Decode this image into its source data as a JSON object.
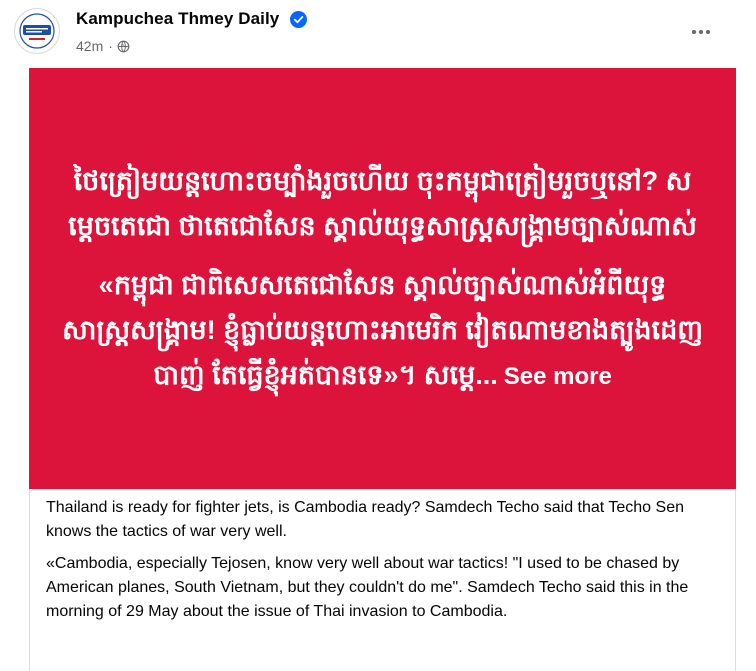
{
  "post": {
    "page_name": "Kampuchea Thmey Daily",
    "time": "42m",
    "separator": "·",
    "verified_icon": "verified-check-icon",
    "privacy_icon": "globe-icon",
    "menu_icon": "more-horizontal-icon"
  },
  "media": {
    "background_color": "#dc143c",
    "headline": "ថៃត្រៀមយន្តហោះចម្បាំងរួចហើយ ចុះកម្ពុជាត្រៀមរួចឬនៅ? សម្តេចតេជោ ថាតេជោសែន ស្គាល់យុទ្ធសាស្ត្រសង្គ្រាមច្បាស់ណាស់",
    "quote": "«កម្ពុជា ជាពិសេសតេជោសែន ស្គាល់ច្បាស់ណាស់អំពីយុទ្ធសាស្ត្រសង្គ្រាម! ខ្ញុំធ្លាប់យន្តហោះអាមេរិក វៀតណាមខាងត្បូងដេញបាញ់ តែធ្វើខ្ញុំអត់បានទេ»។ សម្តេ...",
    "see_more": "See more"
  },
  "translation": {
    "paragraph_1": "Thailand is ready for fighter jets, is Cambodia ready? Samdech Techo said that Techo Sen knows the tactics of war very well.",
    "paragraph_2": "«Cambodia, especially Tejosen, know very well about war tactics! \"I used to be chased by American planes, South Vietnam, but they couldn't do me\". Samdech Techo said this in the morning of 29 May about the issue of Thai invasion to Cambodia."
  }
}
